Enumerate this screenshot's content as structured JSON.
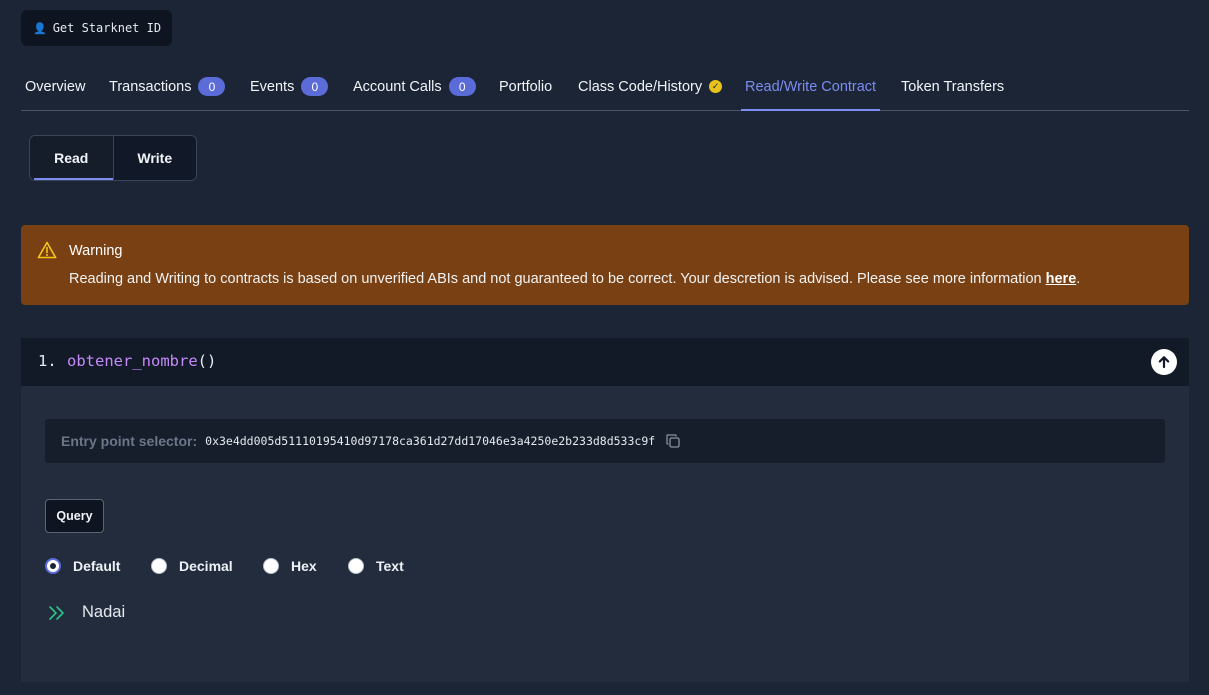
{
  "starknet_button": {
    "icon": "person-icon",
    "label": "Get Starknet ID"
  },
  "tabs": [
    {
      "label": "Overview"
    },
    {
      "label": "Transactions",
      "badge": "0"
    },
    {
      "label": "Events",
      "badge": "0"
    },
    {
      "label": "Account Calls",
      "badge": "0"
    },
    {
      "label": "Portfolio"
    },
    {
      "label": "Class Code/History",
      "icon": "verified-check-icon"
    },
    {
      "label": "Read/Write Contract",
      "active": true
    },
    {
      "label": "Token Transfers"
    }
  ],
  "mode_toggle": {
    "read_label": "Read",
    "write_label": "Write",
    "active": "Read"
  },
  "warning": {
    "title": "Warning",
    "text": "Reading and Writing to contracts is based on unverified ABIs and not guaranteed to be correct. Your descretion is advised. Please see more information ",
    "link_text": "here",
    "trailing": ".",
    "color": "#784013"
  },
  "function": {
    "number": "1.",
    "name": "obtener_nombre",
    "params": "()",
    "selector_label": "Entry point selector:",
    "selector_value": "0x3e4dd005d51110195410d97178ca361d27dd17046e3a4250e2b233d8d533c9f",
    "query_label": "Query",
    "formats": [
      "Default",
      "Decimal",
      "Hex",
      "Text"
    ],
    "selected_format": "Default",
    "result_value": "Nadai"
  },
  "colors": {
    "accent": "#7c8cf0",
    "background": "#1b2535",
    "function_name": "#c58af9",
    "result_arrow": "#2ec28a"
  }
}
